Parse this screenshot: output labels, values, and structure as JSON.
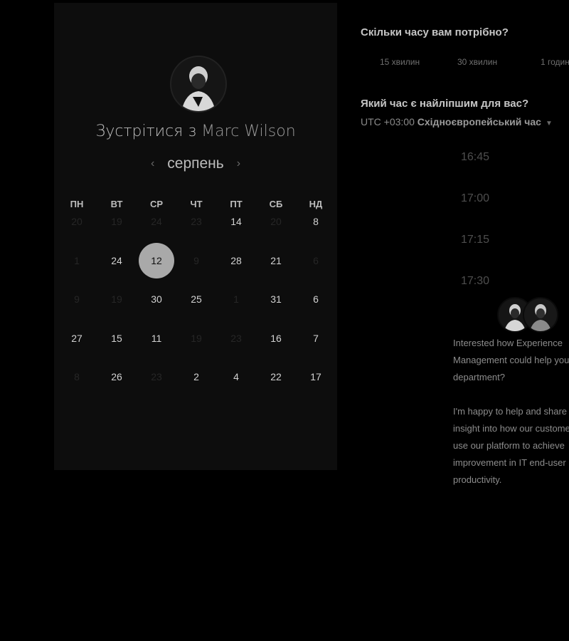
{
  "header": {
    "title_prefix": "Зустрітися з",
    "host_name": "Marc Wilson"
  },
  "calendar": {
    "month": "серпень",
    "weekdays": [
      "ПН",
      "ВТ",
      "СР",
      "ЧТ",
      "ПТ",
      "СБ",
      "НД"
    ],
    "rows": [
      [
        {
          "t": "20",
          "s": "muted"
        },
        {
          "t": "19",
          "s": "muted"
        },
        {
          "t": "24",
          "s": "muted"
        },
        {
          "t": "23",
          "s": "muted"
        },
        {
          "t": "14",
          "s": "active"
        },
        {
          "t": "20",
          "s": "muted"
        },
        {
          "t": "8",
          "s": "active"
        }
      ],
      [
        {
          "t": "1",
          "s": "muted"
        },
        {
          "t": "24",
          "s": "active"
        },
        {
          "t": "12",
          "s": "selected"
        },
        {
          "t": "9",
          "s": "muted"
        },
        {
          "t": "28",
          "s": "active"
        },
        {
          "t": "21",
          "s": "active"
        },
        {
          "t": "6",
          "s": "muted"
        }
      ],
      [
        {
          "t": "9",
          "s": "muted"
        },
        {
          "t": "19",
          "s": "muted"
        },
        {
          "t": "30",
          "s": "active"
        },
        {
          "t": "25",
          "s": "active"
        },
        {
          "t": "1",
          "s": "muted"
        },
        {
          "t": "31",
          "s": "active"
        },
        {
          "t": "6",
          "s": "active"
        }
      ],
      [
        {
          "t": "27",
          "s": "active"
        },
        {
          "t": "15",
          "s": "active"
        },
        {
          "t": "11",
          "s": "active"
        },
        {
          "t": "19",
          "s": "muted"
        },
        {
          "t": "23",
          "s": "muted"
        },
        {
          "t": "16",
          "s": "active"
        },
        {
          "t": "7",
          "s": "active"
        }
      ],
      [
        {
          "t": "8",
          "s": "muted"
        },
        {
          "t": "26",
          "s": "active"
        },
        {
          "t": "23",
          "s": "muted"
        },
        {
          "t": "2",
          "s": "active"
        },
        {
          "t": "4",
          "s": "active"
        },
        {
          "t": "22",
          "s": "active"
        },
        {
          "t": "17",
          "s": "active"
        }
      ]
    ]
  },
  "duration": {
    "question": "Скільки часу вам потрібно?",
    "options": [
      "15 хвилин",
      "30 хвилин",
      "1 годин"
    ]
  },
  "time": {
    "question": "Який час є найліпшим для вас?",
    "tz_offset": "UTC +03:00",
    "tz_name": "Східноєвропейський час",
    "slots": [
      "16:45",
      "17:00",
      "17:15",
      "17:30"
    ]
  },
  "bio": {
    "para1": "Interested how Experience Management could help you department?",
    "para2": "I'm happy to help and share insight into how our customers use our platform to achieve improvement in IT end-user productivity."
  }
}
